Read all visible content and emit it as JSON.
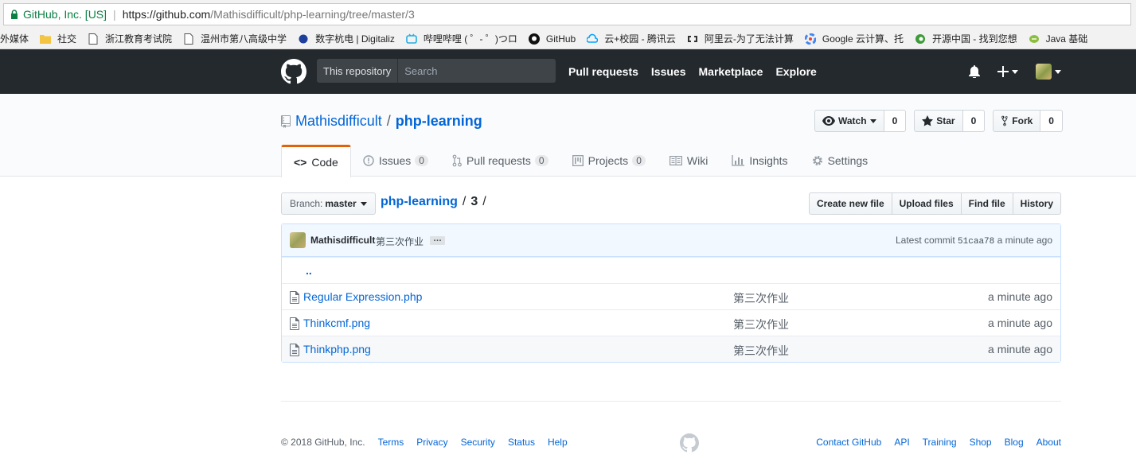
{
  "browser": {
    "org": "GitHub, Inc. [US]",
    "url_host": "https://github.com",
    "url_path": "/Mathisdifficult/php-learning/tree/master/3",
    "bookmarks": [
      {
        "label": "外媒体",
        "icon": "none"
      },
      {
        "label": "社交",
        "icon": "folder-icon",
        "color": "#f4c542"
      },
      {
        "label": "浙江教育考试院",
        "icon": "page-icon"
      },
      {
        "label": "温州市第八高级中学",
        "icon": "page-icon"
      },
      {
        "label": "数字杭电 | Digitaliz",
        "icon": "hdu-icon",
        "color": "#1e3f9c"
      },
      {
        "label": "哔哩哔哩 ( ゜- ゜)つロ",
        "icon": "bilibili-icon",
        "color": "#23ade5"
      },
      {
        "label": "GitHub",
        "icon": "github-icon"
      },
      {
        "label": "云+校园 - 腾讯云",
        "icon": "tencent-cloud-icon",
        "color": "#00a4ff"
      },
      {
        "label": "阿里云-为了无法计算",
        "icon": "aliyun-icon"
      },
      {
        "label": "Google 云计算、托",
        "icon": "google-cloud-icon"
      },
      {
        "label": "开源中国 - 找到您想",
        "icon": "oschina-icon",
        "color": "#3e9b3a"
      },
      {
        "label": "Java 基础",
        "icon": "java-icon",
        "color": "#8cbf3f"
      }
    ]
  },
  "header": {
    "search_scope": "This repository",
    "search_placeholder": "Search",
    "nav": [
      "Pull requests",
      "Issues",
      "Marketplace",
      "Explore"
    ]
  },
  "repo": {
    "owner": "Mathisdifficult",
    "name": "php-learning",
    "watch_label": "Watch",
    "watch_count": "0",
    "star_label": "Star",
    "star_count": "0",
    "fork_label": "Fork",
    "fork_count": "0",
    "tabs": [
      {
        "label": "Code",
        "count": ""
      },
      {
        "label": "Issues",
        "count": "0"
      },
      {
        "label": "Pull requests",
        "count": "0"
      },
      {
        "label": "Projects",
        "count": "0"
      },
      {
        "label": "Wiki",
        "count": ""
      },
      {
        "label": "Insights",
        "count": ""
      },
      {
        "label": "Settings",
        "count": ""
      }
    ]
  },
  "filenav": {
    "branch_label": "Branch:",
    "branch": "master",
    "crumb_repo": "php-learning",
    "crumb_dir": "3",
    "crumb_sep": "/",
    "buttons": [
      "Create new file",
      "Upload files",
      "Find file",
      "History"
    ]
  },
  "commit": {
    "author": "Mathisdifficult",
    "message": "第三次作业",
    "ellipsis": "…",
    "latest_label": "Latest commit",
    "sha": "51caa78",
    "age": "a minute ago"
  },
  "files": {
    "parent": "..",
    "rows": [
      {
        "name": "Regular Expression.php",
        "message": "第三次作业",
        "age": "a minute ago"
      },
      {
        "name": "Thinkcmf.png",
        "message": "第三次作业",
        "age": "a minute ago"
      },
      {
        "name": "Thinkphp.png",
        "message": "第三次作业",
        "age": "a minute ago"
      }
    ]
  },
  "footer": {
    "copyright": "© 2018 GitHub, Inc.",
    "left_links": [
      "Terms",
      "Privacy",
      "Security",
      "Status",
      "Help"
    ],
    "right_links": [
      "Contact GitHub",
      "API",
      "Training",
      "Shop",
      "Blog",
      "About"
    ]
  },
  "colors": {
    "header_bg": "#24292e",
    "link": "#0366d6",
    "selected_tab_accent": "#e36209"
  }
}
